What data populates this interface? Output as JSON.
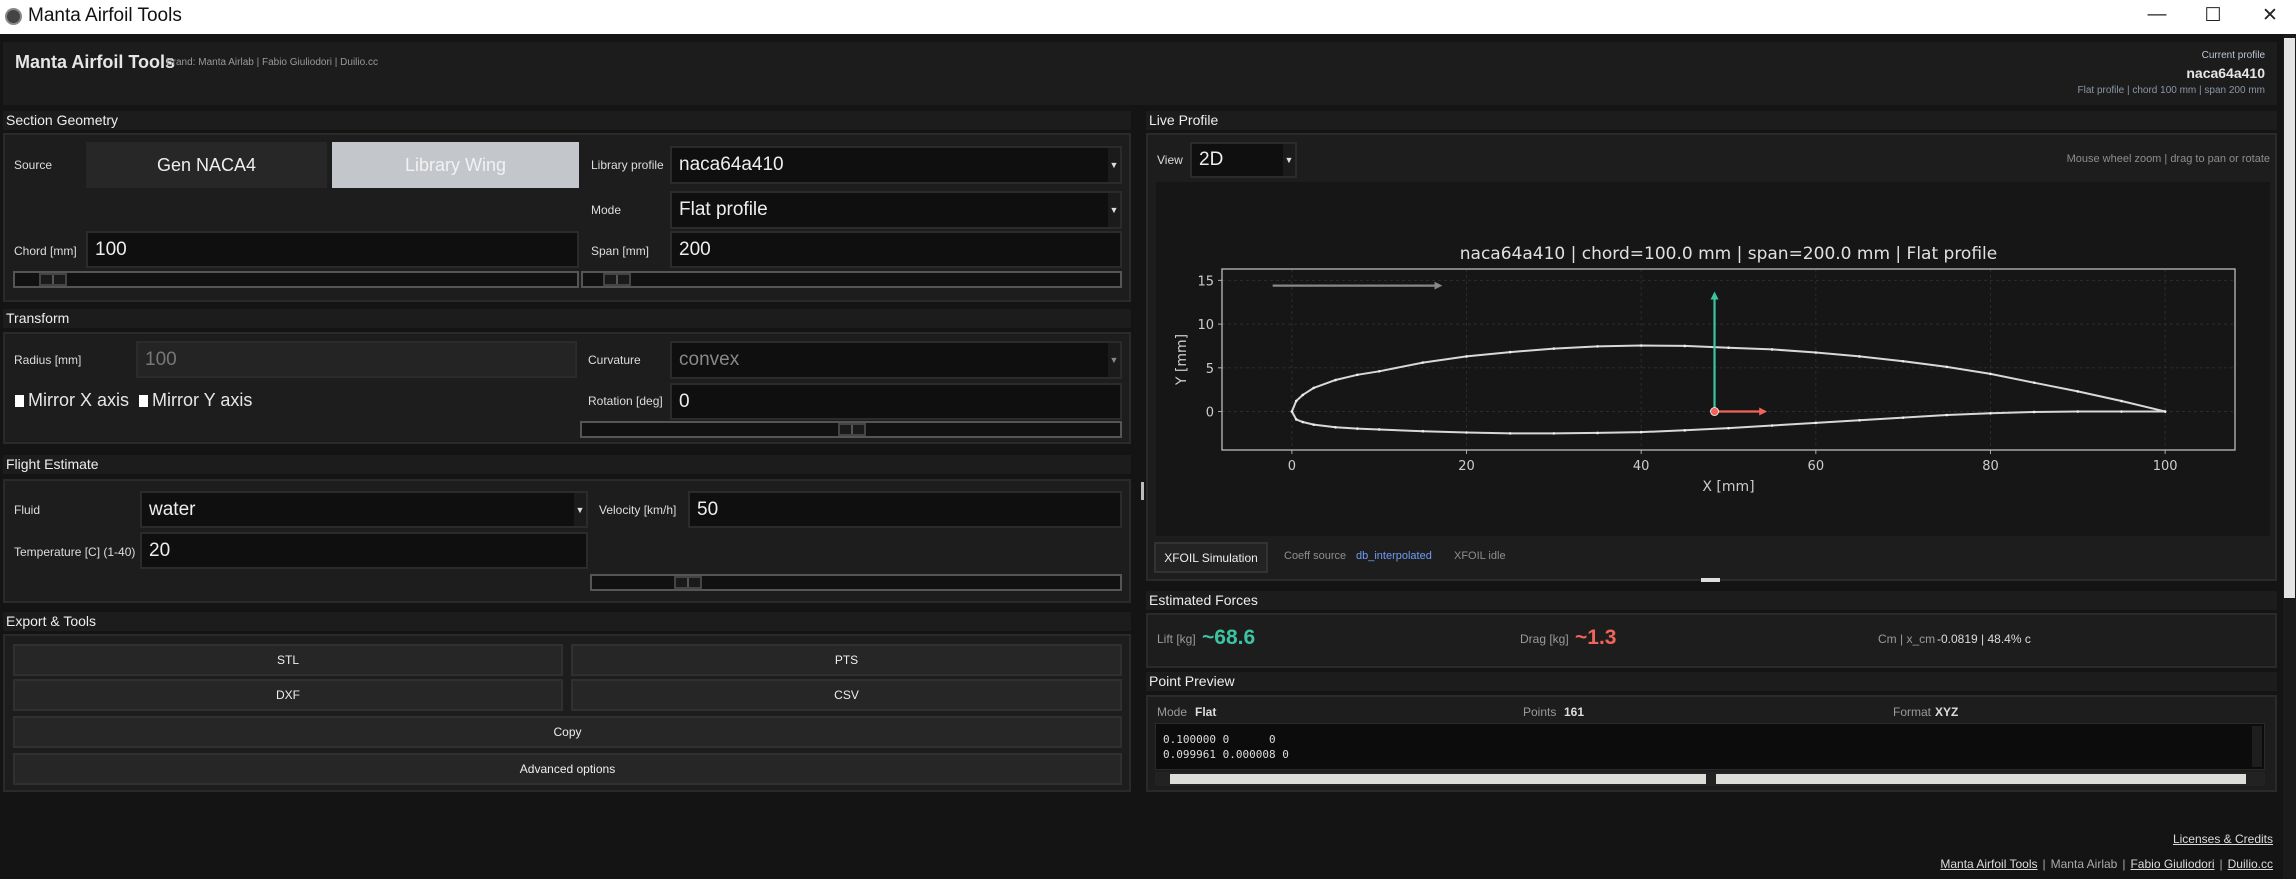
{
  "window": {
    "title": "Manta Airfoil Tools",
    "minimize": "—",
    "maximize": "☐",
    "close": "✕"
  },
  "header": {
    "title": "Manta Airfoil Tools",
    "brand": "Brand: Manta Airlab | Fabio Giuliodori | Duilio.cc",
    "current_label": "Current profile",
    "current_profile": "naca64a410",
    "current_meta": "Flat profile | chord 100 mm | span 200 mm"
  },
  "geometry": {
    "title": "Section Geometry",
    "source_label": "Source",
    "source_options": [
      "Gen NACA4",
      "Library Wing"
    ],
    "library_label": "Library profile",
    "library_value": "naca64a410",
    "mode_label": "Mode",
    "mode_value": "Flat profile",
    "chord_label": "Chord [mm]",
    "chord_value": "100",
    "span_label": "Span [mm]",
    "span_value": "200",
    "chord_slider": 0.04,
    "span_slider": 0.04
  },
  "transform": {
    "title": "Transform",
    "radius_label": "Radius [mm]",
    "radius_value": "100",
    "curvature_label": "Curvature",
    "curvature_value": "convex",
    "mirror_x": "Mirror X axis",
    "mirror_y": "Mirror Y axis",
    "rotation_label": "Rotation [deg]",
    "rotation_value": "0",
    "rotation_slider": 0.5
  },
  "flight": {
    "title": "Flight Estimate",
    "fluid_label": "Fluid",
    "fluid_value": "water",
    "velocity_label": "Velocity [km/h]",
    "velocity_value": "50",
    "temp_label": "Temperature [C] (1-40)",
    "temp_value": "20",
    "velocity_slider": 0.16
  },
  "export": {
    "title": "Export & Tools",
    "stl": "STL",
    "pts": "PTS",
    "dxf": "DXF",
    "csv": "CSV",
    "copy": "Copy",
    "advanced": "Advanced options"
  },
  "live": {
    "title": "Live Profile",
    "view_label": "View",
    "view_value": "2D",
    "hint": "Mouse wheel zoom | drag to pan or rotate",
    "xfoil_button": "XFOIL Simulation",
    "coeff_label": "Coeff source",
    "coeff_value": "db_interpolated",
    "xfoil_status": "XFOIL idle"
  },
  "forces": {
    "title": "Estimated Forces",
    "lift_label": "Lift [kg]",
    "lift_value": "~68.6",
    "drag_label": "Drag [kg]",
    "drag_value": "~1.3",
    "cm_label": "Cm | x_cm",
    "cm_value": "-0.0819 | 48.4% c",
    "lift_color": "#3cc4a2",
    "drag_color": "#f0645a"
  },
  "preview": {
    "title": "Point Preview",
    "mode_label": "Mode",
    "mode_value": "Flat",
    "points_label": "Points",
    "points_value": "161",
    "format_label": "Format",
    "format_value": "XYZ",
    "lines": [
      "0.100000 0      0",
      "0.099961 0.000008 0"
    ]
  },
  "footer": {
    "licenses": "Licenses & Credits",
    "links": [
      "Manta Airfoil Tools",
      "Manta Airlab",
      "Fabio Giuliodori",
      "Duilio.cc"
    ],
    "sep": "|"
  },
  "chart_data": {
    "type": "line",
    "title": "naca64a410 | chord=100.0 mm | span=200.0 mm | Flat profile",
    "xlabel": "X [mm]",
    "ylabel": "Y [mm]",
    "xlim": [
      -8,
      108
    ],
    "ylim": [
      -4.4,
      16.3
    ],
    "xticks": [
      0,
      20,
      40,
      60,
      80,
      100
    ],
    "yticks": [
      0,
      5,
      10,
      15
    ],
    "grid": true,
    "upper": [
      [
        0,
        0
      ],
      [
        0.5,
        1.2
      ],
      [
        1.25,
        1.9
      ],
      [
        2.5,
        2.7
      ],
      [
        5,
        3.6
      ],
      [
        7.5,
        4.2
      ],
      [
        10,
        4.6
      ],
      [
        15,
        5.6
      ],
      [
        20,
        6.3
      ],
      [
        25,
        6.8
      ],
      [
        30,
        7.2
      ],
      [
        35,
        7.45
      ],
      [
        40,
        7.55
      ],
      [
        45,
        7.5
      ],
      [
        50,
        7.3
      ],
      [
        55,
        7.1
      ],
      [
        60,
        6.75
      ],
      [
        65,
        6.3
      ],
      [
        70,
        5.75
      ],
      [
        75,
        5.1
      ],
      [
        80,
        4.3
      ],
      [
        85,
        3.3
      ],
      [
        90,
        2.3
      ],
      [
        95,
        1.2
      ],
      [
        100,
        0
      ]
    ],
    "lower": [
      [
        0,
        0
      ],
      [
        0.5,
        -0.9
      ],
      [
        1.25,
        -1.2
      ],
      [
        2.5,
        -1.5
      ],
      [
        5,
        -1.8
      ],
      [
        7.5,
        -1.95
      ],
      [
        10,
        -2.05
      ],
      [
        15,
        -2.25
      ],
      [
        20,
        -2.4
      ],
      [
        25,
        -2.5
      ],
      [
        30,
        -2.5
      ],
      [
        35,
        -2.45
      ],
      [
        40,
        -2.35
      ],
      [
        45,
        -2.15
      ],
      [
        50,
        -1.9
      ],
      [
        55,
        -1.6
      ],
      [
        60,
        -1.3
      ],
      [
        65,
        -1.0
      ],
      [
        70,
        -0.7
      ],
      [
        75,
        -0.4
      ],
      [
        80,
        -0.2
      ],
      [
        85,
        -0.05
      ],
      [
        90,
        0
      ],
      [
        95,
        0
      ],
      [
        100,
        0
      ]
    ],
    "flow_arrow": [
      [
        -2.2,
        14.4
      ],
      [
        17,
        14.4
      ]
    ],
    "lift_arrow": [
      [
        48.4,
        0
      ],
      [
        48.4,
        13.5
      ]
    ],
    "drag_arrow": [
      [
        48.4,
        0
      ],
      [
        54.2,
        0
      ]
    ],
    "center": [
      48.4,
      0
    ],
    "colors": {
      "outline": "#d8d8d8",
      "flow": "#888888",
      "lift": "#3cc4a2",
      "drag": "#f0645a"
    }
  }
}
